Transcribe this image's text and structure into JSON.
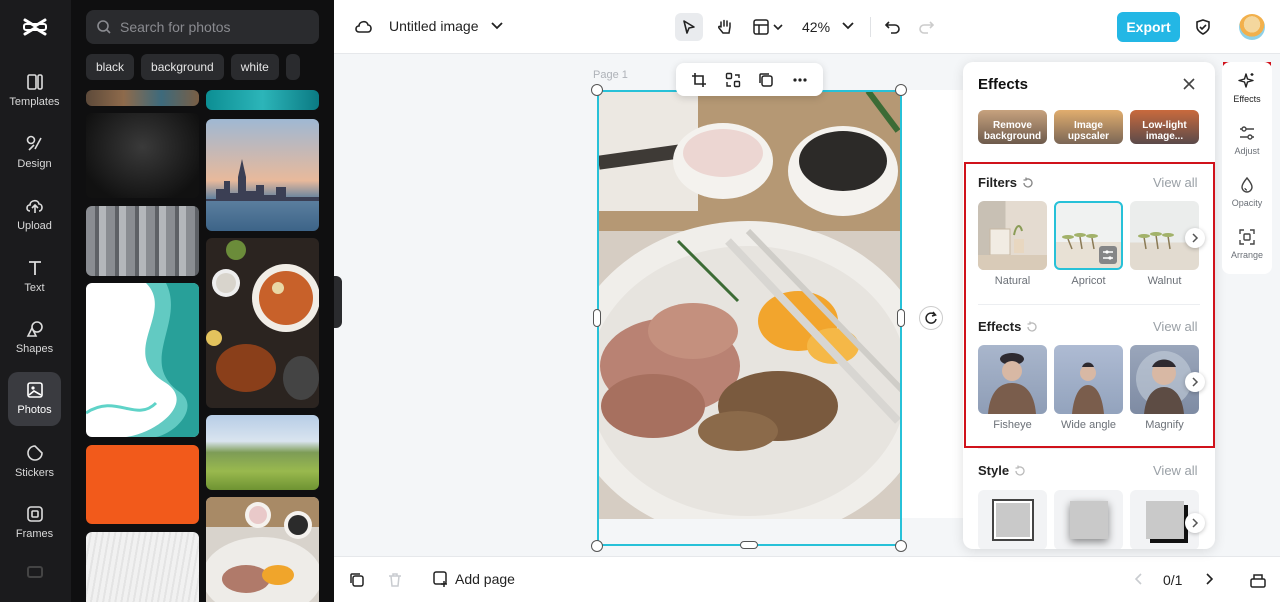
{
  "rail": {
    "items": [
      {
        "label": "Templates",
        "icon": "templates-icon"
      },
      {
        "label": "Design",
        "icon": "design-icon"
      },
      {
        "label": "Upload",
        "icon": "upload-icon"
      },
      {
        "label": "Text",
        "icon": "text-icon"
      },
      {
        "label": "Shapes",
        "icon": "shapes-icon"
      },
      {
        "label": "Photos",
        "icon": "photos-icon",
        "active": true
      },
      {
        "label": "Stickers",
        "icon": "stickers-icon"
      },
      {
        "label": "Frames",
        "icon": "frames-icon"
      }
    ]
  },
  "photos": {
    "search_placeholder": "Search for photos",
    "chips": [
      "black",
      "background",
      "white"
    ]
  },
  "topbar": {
    "doc_title": "Untitled image",
    "zoom": "42%",
    "export_label": "Export"
  },
  "canvas": {
    "page_label": "Page 1"
  },
  "bottombar": {
    "add_page_label": "Add page",
    "page_count": "0/1"
  },
  "effects_panel": {
    "title": "Effects",
    "tools": [
      {
        "label": "Remove background"
      },
      {
        "label": "Image upscaler"
      },
      {
        "label": "Low-light image..."
      }
    ],
    "filters": {
      "title": "Filters",
      "view_all": "View all",
      "items": [
        {
          "label": "Natural"
        },
        {
          "label": "Apricot",
          "selected": true
        },
        {
          "label": "Walnut"
        }
      ]
    },
    "effects": {
      "title": "Effects",
      "view_all": "View all",
      "items": [
        {
          "label": "Fisheye"
        },
        {
          "label": "Wide angle"
        },
        {
          "label": "Magnify"
        }
      ]
    },
    "style": {
      "title": "Style",
      "view_all": "View all"
    }
  },
  "right_rail": {
    "items": [
      {
        "label": "Effects",
        "active": true
      },
      {
        "label": "Adjust"
      },
      {
        "label": "Opacity"
      },
      {
        "label": "Arrange"
      }
    ]
  },
  "colors": {
    "accent": "#23b7e5",
    "selection": "#27c1d8",
    "highlight": "#d0121b",
    "rail_bg": "#1b1b1d"
  }
}
